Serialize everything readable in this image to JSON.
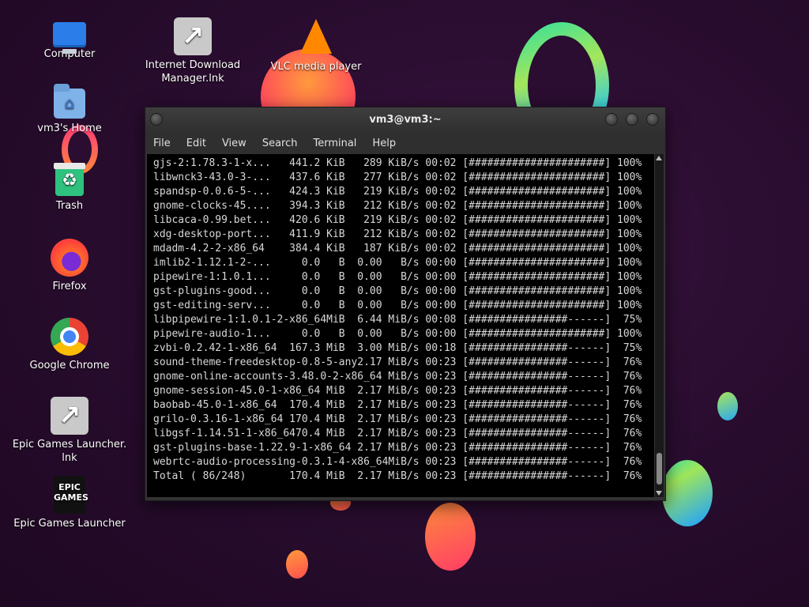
{
  "desktop": {
    "icons": [
      {
        "label": "Computer"
      },
      {
        "label": "vm3's Home"
      },
      {
        "label": "Trash"
      },
      {
        "label": "Firefox"
      },
      {
        "label": "Google Chrome"
      },
      {
        "label": "Epic Games Launcher.\nlnk"
      },
      {
        "label": "Epic Games Launcher",
        "glyph_text": "EPIC\nGAMES"
      },
      {
        "label": "Internet Download\nManager.lnk"
      },
      {
        "label": "VLC media player"
      }
    ]
  },
  "window": {
    "title": "vm3@vm3:~",
    "menu": [
      "File",
      "Edit",
      "View",
      "Search",
      "Terminal",
      "Help"
    ]
  },
  "terminal": {
    "lines": [
      "gjs-2:1.78.3-1-x...   441.2 KiB   289 KiB/s 00:02 [######################] 100%",
      "libwnck3-43.0-3-...   437.6 KiB   277 KiB/s 00:02 [######################] 100%",
      "spandsp-0.0.6-5-...   424.3 KiB   219 KiB/s 00:02 [######################] 100%",
      "gnome-clocks-45....   394.3 KiB   212 KiB/s 00:02 [######################] 100%",
      "libcaca-0.99.bet...   420.6 KiB   219 KiB/s 00:02 [######################] 100%",
      "xdg-desktop-port...   411.9 KiB   212 KiB/s 00:02 [######################] 100%",
      "mdadm-4.2-2-x86_64    384.4 KiB   187 KiB/s 00:02 [######################] 100%",
      "imlib2-1.12.1-2-...     0.0   B  0.00   B/s 00:00 [######################] 100%",
      "pipewire-1:1.0.1...     0.0   B  0.00   B/s 00:00 [######################] 100%",
      "gst-plugins-good...     0.0   B  0.00   B/s 00:00 [######################] 100%",
      "gst-editing-serv...     0.0   B  0.00   B/s 00:00 [######################] 100%",
      "libpipewire-1:1.0.1-2-x86_64MiB  6.44 MiB/s 00:08 [################------]  75%",
      "pipewire-audio-1...     0.0   B  0.00   B/s 00:00 [######################] 100%",
      "zvbi-0.2.42-1-x86_64  167.3 MiB  3.00 MiB/s 00:18 [################------]  75%",
      "sound-theme-freedesktop-0.8-5-any2.17 MiB/s 00:23 [################------]  76%",
      "gnome-online-accounts-3.48.0-2-x86_64 MiB/s 00:23 [################------]  76%",
      "gnome-session-45.0-1-x86_64 MiB  2.17 MiB/s 00:23 [################------]  76%",
      "baobab-45.0-1-x86_64  170.4 MiB  2.17 MiB/s 00:23 [################------]  76%",
      "grilo-0.3.16-1-x86_64 170.4 MiB  2.17 MiB/s 00:23 [################------]  76%",
      "libgsf-1.14.51-1-x86_6470.4 MiB  2.17 MiB/s 00:23 [################------]  76%",
      "gst-plugins-base-1.22.9-1-x86_64 2.17 MiB/s 00:23 [################------]  76%",
      "webrtc-audio-processing-0.3.1-4-x86_64MiB/s 00:23 [################------]  76%",
      "Total ( 86/248)       170.4 MiB  2.17 MiB/s 00:23 [################------]  76%"
    ]
  }
}
